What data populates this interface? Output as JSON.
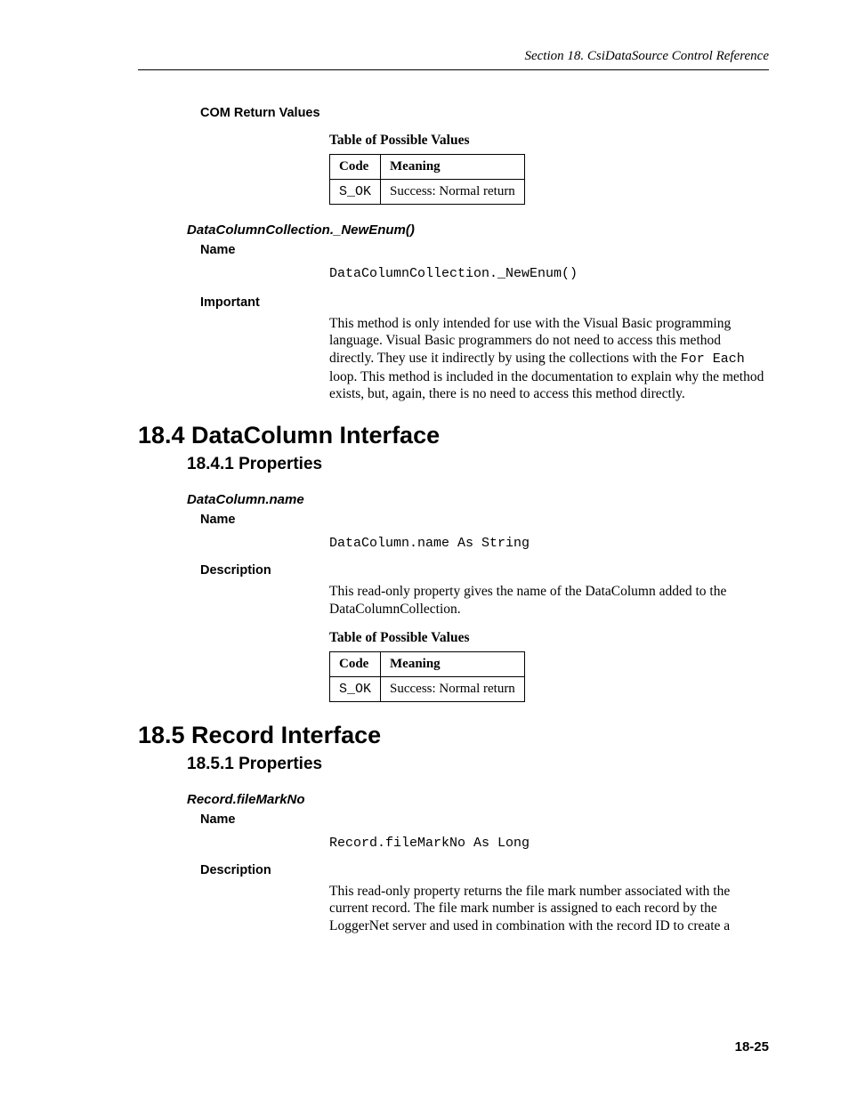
{
  "header": {
    "text": "Section 18.  CsiDataSource Control Reference"
  },
  "section1": {
    "comReturn": "COM Return Values",
    "tableCaption": "Table of Possible Values",
    "table": {
      "h1": "Code",
      "h2": "Meaning",
      "c1": "S_OK",
      "c2": "Success: Normal return"
    },
    "methodTitle": "DataColumnCollection._NewEnum()",
    "nameLabel": "Name",
    "nameCode": "DataColumnCollection._NewEnum()",
    "importantLabel": "Important",
    "importantText1": "This method is only intended for use with the Visual Basic programming language.  Visual Basic programmers do not need to access this method directly.  They use it indirectly by using the collections with the ",
    "importantMono": "For Each",
    "importantText2": " loop.  This method is included in the documentation to explain why the method exists, but, again, there is no need to access this method directly."
  },
  "section2": {
    "h1": "18.4  DataColumn Interface",
    "h2": "18.4.1  Properties",
    "methodTitle": "DataColumn.name",
    "nameLabel": "Name",
    "nameCode": "DataColumn.name As String",
    "descLabel": "Description",
    "descText": "This read-only property gives the name of the DataColumn added to the DataColumnCollection.",
    "tableCaption": "Table of Possible Values",
    "table": {
      "h1": "Code",
      "h2": "Meaning",
      "c1": "S_OK",
      "c2": "Success: Normal return"
    }
  },
  "section3": {
    "h1": "18.5  Record Interface",
    "h2": "18.5.1  Properties",
    "methodTitle": "Record.fileMarkNo",
    "nameLabel": "Name",
    "nameCode": "Record.fileMarkNo As Long",
    "descLabel": "Description",
    "descText": "This read-only property returns the file mark number associated with the current record.  The file mark number is assigned to each record by the LoggerNet server and used in combination with the record ID to create a"
  },
  "pageNumber": "18-25"
}
